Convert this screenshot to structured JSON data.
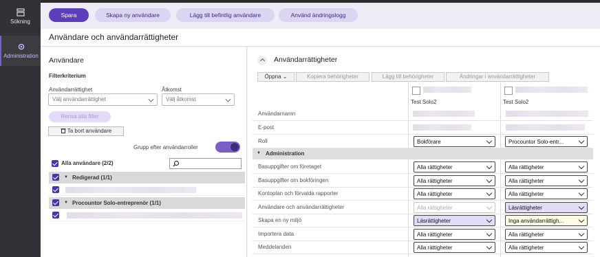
{
  "rail": {
    "search_label": "Sökning",
    "admin_label": "Administration"
  },
  "actions": {
    "save": "Spara",
    "create_user": "Skapa ny användare",
    "add_existing": "Lägg till befintlig användare",
    "use_changelog": "Använd ändringslogg"
  },
  "page_title": "Användare och användarrättigheter",
  "users_panel": {
    "heading": "Användare",
    "filter_heading": "Filterkriterium",
    "rights_label": "Användarrättighet",
    "rights_placeholder": "Välj användarrättighet",
    "access_label": "Åtkomst",
    "access_placeholder": "Välj åtkomst",
    "clear_filters": "Rensa alla filter",
    "delete_user": "Ta bort användare",
    "group_by_roles": "Grupp efter användarroller",
    "all_users": "Alla användare (2/2)",
    "groups": [
      {
        "name": "Redigerad (1/1)"
      },
      {
        "name": "Procountor Solo-entreprenör (1/1)"
      }
    ]
  },
  "rights_panel": {
    "heading": "Användarrättigheter",
    "toolbar": {
      "open": "Öppna",
      "copy": "Kopiera behörigheter",
      "add": "Lägg till behörigheter",
      "changes": "Ändringar i användarrättigheter"
    },
    "columns": [
      {
        "name": "Test Solo2"
      },
      {
        "name": "Test Solo2"
      }
    ],
    "info_rows": [
      {
        "label": "Användarnamn"
      },
      {
        "label": "E-post"
      }
    ],
    "role_row": {
      "label": "Roll",
      "values": [
        "Bokförare",
        "Procountor Solo-entr..."
      ]
    },
    "section": "Administration",
    "rows": [
      {
        "label": "Basuppgifter om företaget",
        "values": [
          "Alla rättigheter",
          "Alla rättigheter"
        ]
      },
      {
        "label": "Basuppgifter om bokföringen",
        "values": [
          "Alla rättigheter",
          "Alla rättigheter"
        ]
      },
      {
        "label": "Kontoplan och förvalda rapporter",
        "values": [
          "Alla rättigheter",
          "Alla rättigheter"
        ]
      },
      {
        "label": "Användare och användarrättigheter",
        "values": [
          "Alla rättigheter",
          "Läsrättigheter"
        ]
      },
      {
        "label": "Skapa en ny miljö",
        "values": [
          "Läsrättigheter",
          "Inga användarrättigh..."
        ]
      },
      {
        "label": "Importera data",
        "values": [
          "Alla rättigheter",
          "Alla rättigheter"
        ]
      },
      {
        "label": "Meddelanden",
        "values": [
          "Alla rättigheter",
          "Alla rättigheter"
        ]
      }
    ]
  },
  "colors": {
    "accent": "#5b3fb8",
    "accent_light": "#dcd4f3",
    "rail": "#303236"
  }
}
